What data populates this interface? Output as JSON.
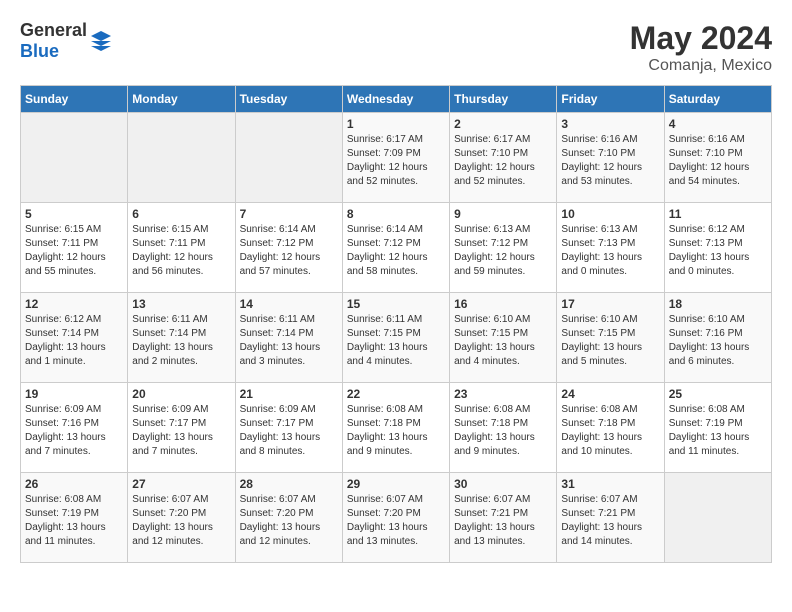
{
  "header": {
    "logo_general": "General",
    "logo_blue": "Blue",
    "month_year": "May 2024",
    "location": "Comanja, Mexico"
  },
  "days_of_week": [
    "Sunday",
    "Monday",
    "Tuesday",
    "Wednesday",
    "Thursday",
    "Friday",
    "Saturday"
  ],
  "weeks": [
    [
      {
        "day": "",
        "info": ""
      },
      {
        "day": "",
        "info": ""
      },
      {
        "day": "",
        "info": ""
      },
      {
        "day": "1",
        "info": "Sunrise: 6:17 AM\nSunset: 7:09 PM\nDaylight: 12 hours and 52 minutes."
      },
      {
        "day": "2",
        "info": "Sunrise: 6:17 AM\nSunset: 7:10 PM\nDaylight: 12 hours and 52 minutes."
      },
      {
        "day": "3",
        "info": "Sunrise: 6:16 AM\nSunset: 7:10 PM\nDaylight: 12 hours and 53 minutes."
      },
      {
        "day": "4",
        "info": "Sunrise: 6:16 AM\nSunset: 7:10 PM\nDaylight: 12 hours and 54 minutes."
      }
    ],
    [
      {
        "day": "5",
        "info": "Sunrise: 6:15 AM\nSunset: 7:11 PM\nDaylight: 12 hours and 55 minutes."
      },
      {
        "day": "6",
        "info": "Sunrise: 6:15 AM\nSunset: 7:11 PM\nDaylight: 12 hours and 56 minutes."
      },
      {
        "day": "7",
        "info": "Sunrise: 6:14 AM\nSunset: 7:12 PM\nDaylight: 12 hours and 57 minutes."
      },
      {
        "day": "8",
        "info": "Sunrise: 6:14 AM\nSunset: 7:12 PM\nDaylight: 12 hours and 58 minutes."
      },
      {
        "day": "9",
        "info": "Sunrise: 6:13 AM\nSunset: 7:12 PM\nDaylight: 12 hours and 59 minutes."
      },
      {
        "day": "10",
        "info": "Sunrise: 6:13 AM\nSunset: 7:13 PM\nDaylight: 13 hours and 0 minutes."
      },
      {
        "day": "11",
        "info": "Sunrise: 6:12 AM\nSunset: 7:13 PM\nDaylight: 13 hours and 0 minutes."
      }
    ],
    [
      {
        "day": "12",
        "info": "Sunrise: 6:12 AM\nSunset: 7:14 PM\nDaylight: 13 hours and 1 minute."
      },
      {
        "day": "13",
        "info": "Sunrise: 6:11 AM\nSunset: 7:14 PM\nDaylight: 13 hours and 2 minutes."
      },
      {
        "day": "14",
        "info": "Sunrise: 6:11 AM\nSunset: 7:14 PM\nDaylight: 13 hours and 3 minutes."
      },
      {
        "day": "15",
        "info": "Sunrise: 6:11 AM\nSunset: 7:15 PM\nDaylight: 13 hours and 4 minutes."
      },
      {
        "day": "16",
        "info": "Sunrise: 6:10 AM\nSunset: 7:15 PM\nDaylight: 13 hours and 4 minutes."
      },
      {
        "day": "17",
        "info": "Sunrise: 6:10 AM\nSunset: 7:15 PM\nDaylight: 13 hours and 5 minutes."
      },
      {
        "day": "18",
        "info": "Sunrise: 6:10 AM\nSunset: 7:16 PM\nDaylight: 13 hours and 6 minutes."
      }
    ],
    [
      {
        "day": "19",
        "info": "Sunrise: 6:09 AM\nSunset: 7:16 PM\nDaylight: 13 hours and 7 minutes."
      },
      {
        "day": "20",
        "info": "Sunrise: 6:09 AM\nSunset: 7:17 PM\nDaylight: 13 hours and 7 minutes."
      },
      {
        "day": "21",
        "info": "Sunrise: 6:09 AM\nSunset: 7:17 PM\nDaylight: 13 hours and 8 minutes."
      },
      {
        "day": "22",
        "info": "Sunrise: 6:08 AM\nSunset: 7:18 PM\nDaylight: 13 hours and 9 minutes."
      },
      {
        "day": "23",
        "info": "Sunrise: 6:08 AM\nSunset: 7:18 PM\nDaylight: 13 hours and 9 minutes."
      },
      {
        "day": "24",
        "info": "Sunrise: 6:08 AM\nSunset: 7:18 PM\nDaylight: 13 hours and 10 minutes."
      },
      {
        "day": "25",
        "info": "Sunrise: 6:08 AM\nSunset: 7:19 PM\nDaylight: 13 hours and 11 minutes."
      }
    ],
    [
      {
        "day": "26",
        "info": "Sunrise: 6:08 AM\nSunset: 7:19 PM\nDaylight: 13 hours and 11 minutes."
      },
      {
        "day": "27",
        "info": "Sunrise: 6:07 AM\nSunset: 7:20 PM\nDaylight: 13 hours and 12 minutes."
      },
      {
        "day": "28",
        "info": "Sunrise: 6:07 AM\nSunset: 7:20 PM\nDaylight: 13 hours and 12 minutes."
      },
      {
        "day": "29",
        "info": "Sunrise: 6:07 AM\nSunset: 7:20 PM\nDaylight: 13 hours and 13 minutes."
      },
      {
        "day": "30",
        "info": "Sunrise: 6:07 AM\nSunset: 7:21 PM\nDaylight: 13 hours and 13 minutes."
      },
      {
        "day": "31",
        "info": "Sunrise: 6:07 AM\nSunset: 7:21 PM\nDaylight: 13 hours and 14 minutes."
      },
      {
        "day": "",
        "info": ""
      }
    ]
  ]
}
